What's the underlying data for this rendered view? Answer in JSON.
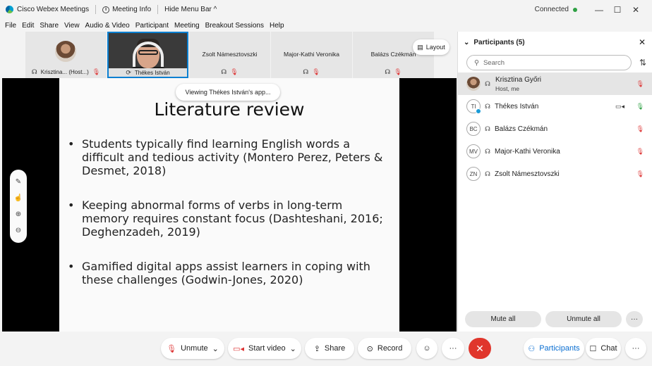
{
  "titlebar": {
    "app_name": "Cisco Webex Meetings",
    "meeting_info": "Meeting Info",
    "hide_menu": "Hide Menu Bar ^",
    "status": "Connected",
    "minimize": "—",
    "maximize": "☐",
    "close": "✕"
  },
  "menu": [
    "File",
    "Edit",
    "Share",
    "View",
    "Audio & Video",
    "Participant",
    "Meeting",
    "Breakout Sessions",
    "Help"
  ],
  "strip": {
    "tiles": [
      {
        "name": "Krisztina... (Host...)"
      },
      {
        "name": "Thékes István"
      },
      {
        "name": "Zsolt Námesztovszki"
      },
      {
        "name": "Major-Kathi Veronika"
      },
      {
        "name": "Balázs Czékmán"
      }
    ],
    "layout_label": "Layout"
  },
  "stage": {
    "viewing_label": "Viewing Thékes István's app...",
    "slide_title": "Literature review",
    "bullets": [
      "Students typically find learning English words a difficult and tedious activity (Montero Perez, Peters & Desmet, 2018)",
      "Keeping abnormal forms of verbs in long-term memory requires constant focus (Dashteshani, 2016; Deghenzadeh, 2019)",
      "Gamified digital apps assist learners in coping with these challenges (Godwin-Jones, 2020)"
    ]
  },
  "panel": {
    "title": "Participants (5)",
    "search_placeholder": "Search",
    "participants": [
      {
        "initials": "",
        "name": "Krisztina Győri",
        "sub": "Host, me",
        "mic": "muted"
      },
      {
        "initials": "TI",
        "name": "Thékes István",
        "sub": "",
        "mic": "on"
      },
      {
        "initials": "BC",
        "name": "Balázs Czékmán",
        "sub": "",
        "mic": "muted"
      },
      {
        "initials": "MV",
        "name": "Major-Kathi Veronika",
        "sub": "",
        "mic": "muted"
      },
      {
        "initials": "ZN",
        "name": "Zsolt Námesztovszki",
        "sub": "",
        "mic": "muted"
      }
    ],
    "mute_all": "Mute all",
    "unmute_all": "Unmute all",
    "more": "···"
  },
  "toolbar": {
    "unmute": "Unmute",
    "start_video": "Start video",
    "share": "Share",
    "record": "Record",
    "more": "···",
    "participants": "Participants",
    "chat": "Chat",
    "overflow": "···"
  },
  "colors": {
    "accent": "#0a6ed1",
    "end_call": "#e0362c",
    "muted": "#dd3333",
    "connected": "#2ea043"
  }
}
